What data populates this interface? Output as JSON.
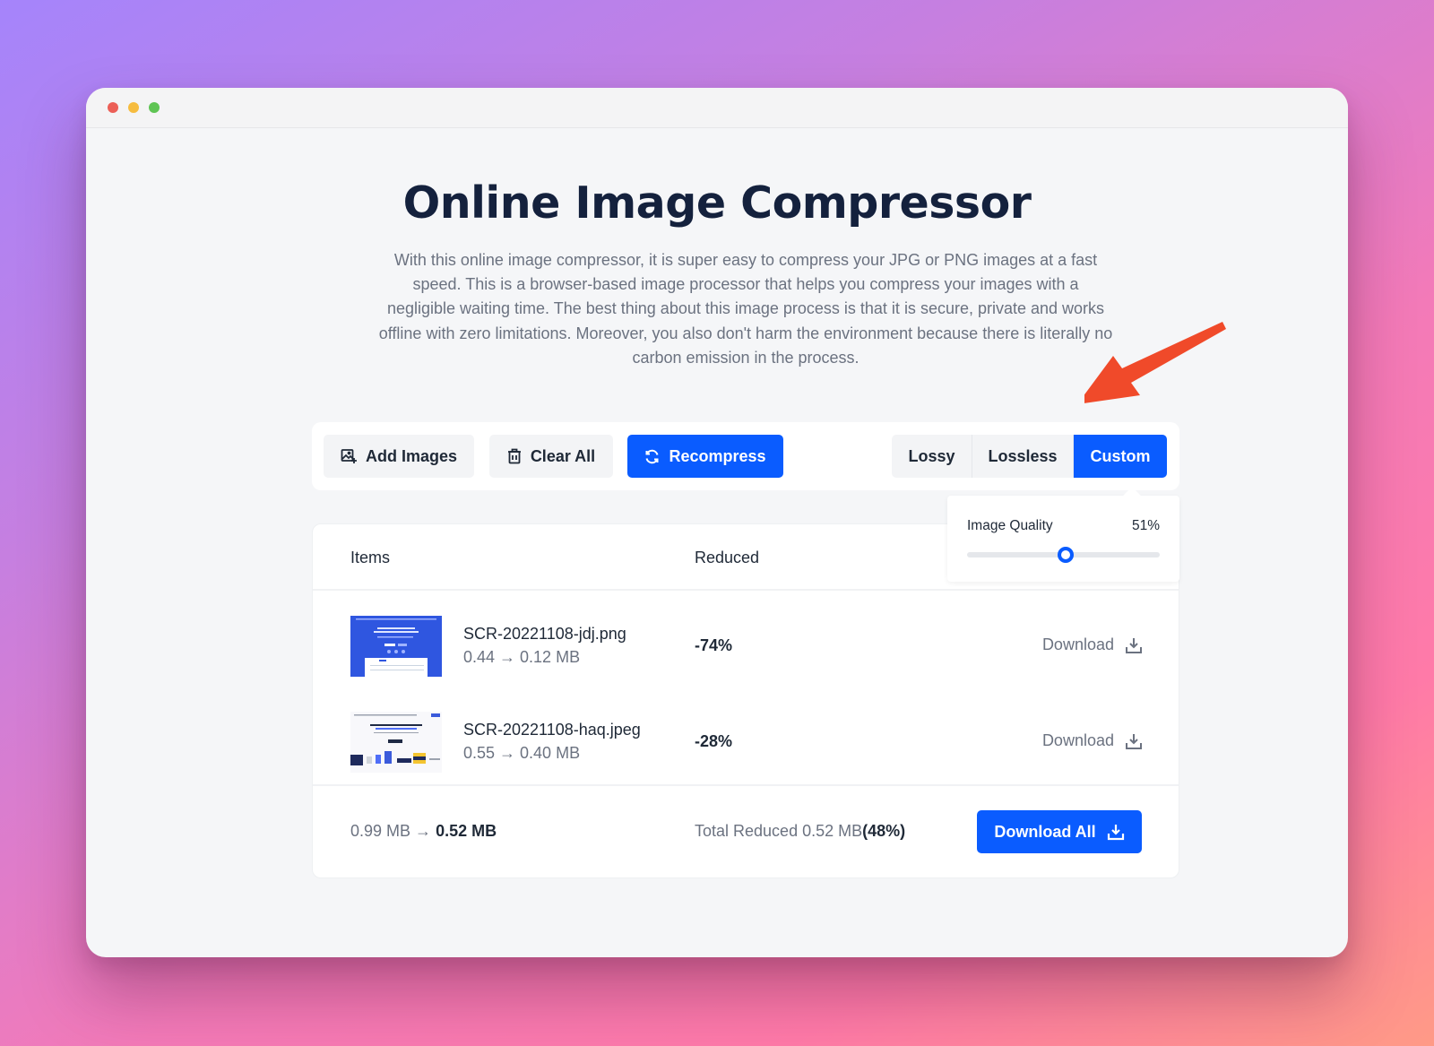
{
  "window": {
    "controls": [
      "close",
      "minimize",
      "maximize"
    ]
  },
  "page": {
    "title": "Online Image Compressor",
    "description": "With this online image compressor, it is super easy to compress your JPG or PNG images at a fast speed. This is a browser-based image processor that helps you compress your images with a negligible waiting time. The best thing about this image process is that it is secure, private and works offline with zero limitations. Moreover, you also don't harm the environment because there is literally no carbon emission in the process."
  },
  "toolbar": {
    "add_images": {
      "label": "Add Images",
      "icon": "image-add-icon"
    },
    "clear_all": {
      "label": "Clear All",
      "icon": "trash-icon"
    },
    "recompress": {
      "label": "Recompress",
      "icon": "refresh-icon"
    },
    "modes": [
      {
        "label": "Lossy",
        "active": false
      },
      {
        "label": "Lossless",
        "active": false
      },
      {
        "label": "Custom",
        "active": true
      }
    ]
  },
  "quality": {
    "label": "Image Quality",
    "value_text": "51%",
    "value": 51
  },
  "table": {
    "headers": {
      "items": "Items",
      "reduced": "Reduced"
    },
    "rows": [
      {
        "filename": "SCR-20221108-jdj.png",
        "sizes": "0.44 → 0.12 MB",
        "reduced": "-74%",
        "download": "Download"
      },
      {
        "filename": "SCR-20221108-haq.jpeg",
        "sizes": "0.55 → 0.40 MB",
        "reduced": "-28%",
        "download": "Download"
      }
    ],
    "footer": {
      "original_total": "0.99 MB →",
      "compressed_total": "0.52 MB",
      "total_reduced_label": "Total Reduced 0.52 MB",
      "total_reduced_percent": "(48%)",
      "download_all": "Download All"
    }
  },
  "colors": {
    "accent": "#0a5cff",
    "title": "#14213d",
    "annotation_arrow": "#f04a2a"
  }
}
